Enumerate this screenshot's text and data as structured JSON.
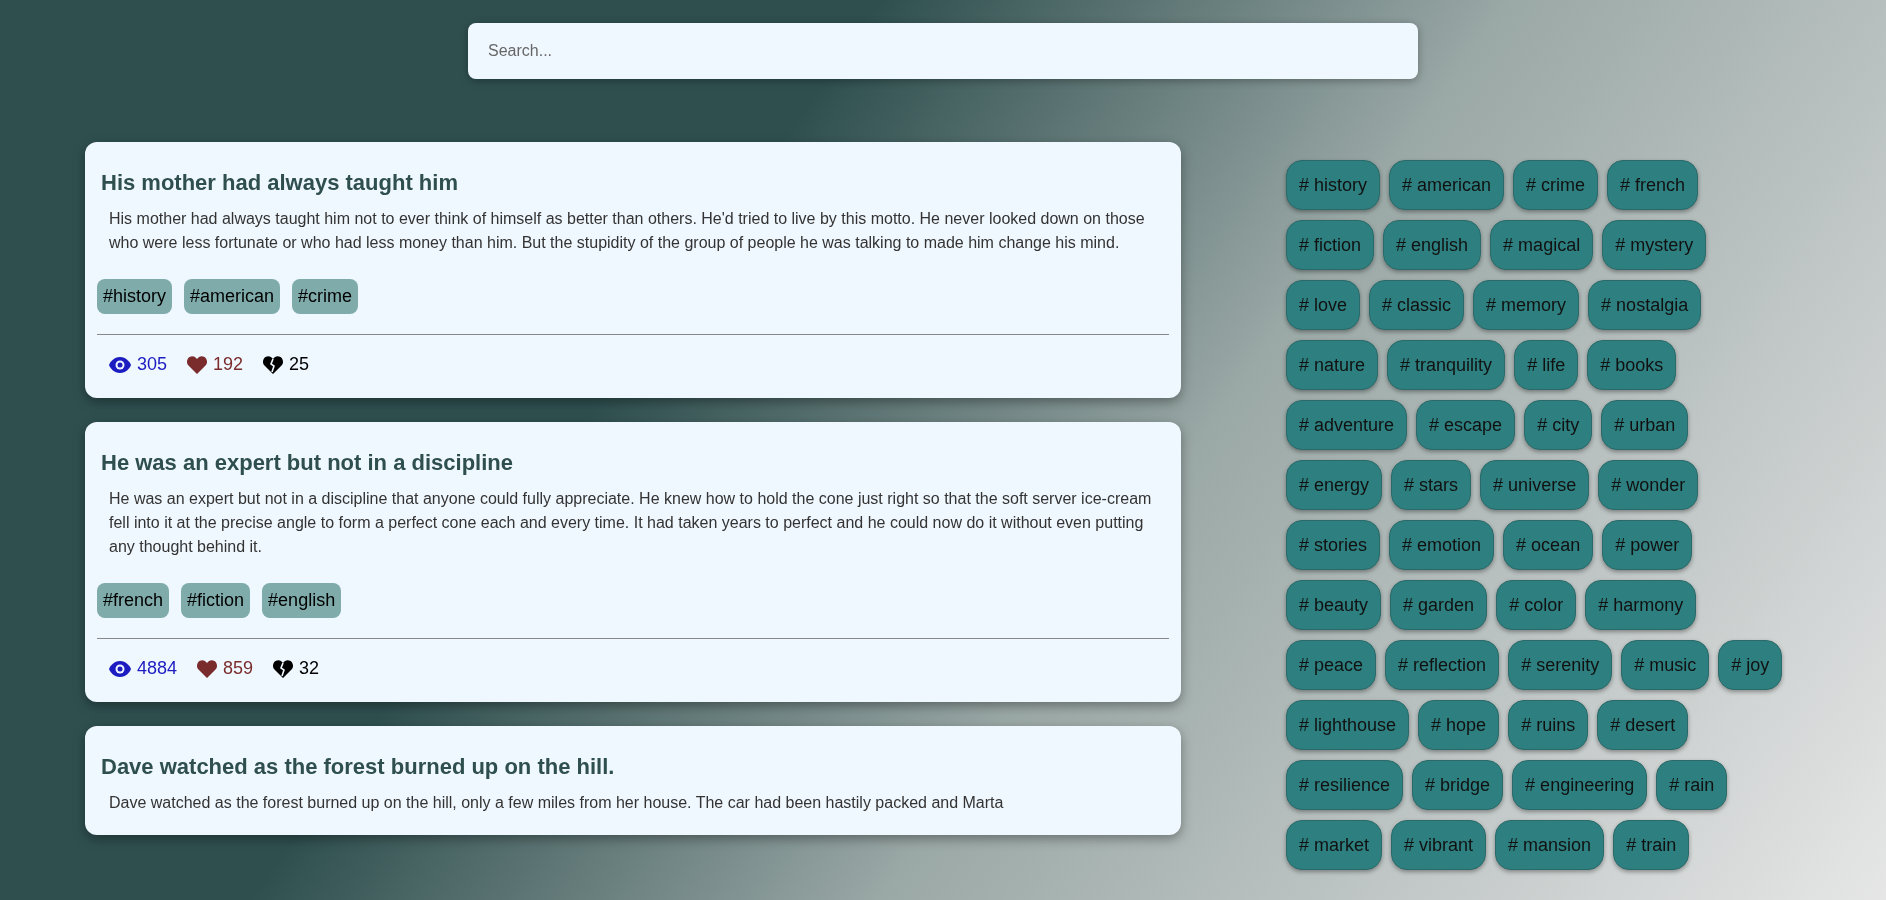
{
  "search": {
    "placeholder": "Search..."
  },
  "posts": [
    {
      "title": "His mother had always taught him",
      "body": "His mother had always taught him not to ever think of himself as better than others. He'd tried to live by this motto. He never looked down on those who were less fortunate or who had less money than him. But the stupidity of the group of people he was talking to made him change his mind.",
      "tags": [
        "#history",
        "#american",
        "#crime"
      ],
      "views": "305",
      "likes": "192",
      "dislikes": "25"
    },
    {
      "title": "He was an expert but not in a discipline",
      "body": "He was an expert but not in a discipline that anyone could fully appreciate. He knew how to hold the cone just right so that the soft server ice-cream fell into it at the precise angle to form a perfect cone each and every time. It had taken years to perfect and he could now do it without even putting any thought behind it.",
      "tags": [
        "#french",
        "#fiction",
        "#english"
      ],
      "views": "4884",
      "likes": "859",
      "dislikes": "32"
    },
    {
      "title": "Dave watched as the forest burned up on the hill.",
      "body": "Dave watched as the forest burned up on the hill, only a few miles from her house. The car had been hastily packed and Marta"
    }
  ],
  "tag_cloud": [
    "# history",
    "# american",
    "# crime",
    "# french",
    "# fiction",
    "# english",
    "# magical",
    "# mystery",
    "# love",
    "# classic",
    "# memory",
    "# nostalgia",
    "# nature",
    "# tranquility",
    "# life",
    "# books",
    "# adventure",
    "# escape",
    "# city",
    "# urban",
    "# energy",
    "# stars",
    "# universe",
    "# wonder",
    "# stories",
    "# emotion",
    "# ocean",
    "# power",
    "# beauty",
    "# garden",
    "# color",
    "# harmony",
    "# peace",
    "# reflection",
    "# serenity",
    "# music",
    "# joy",
    "# lighthouse",
    "# hope",
    "# ruins",
    "# desert",
    "# resilience",
    "# bridge",
    "# engineering",
    "# rain",
    "# market",
    "# vibrant",
    "# mansion",
    "# train"
  ]
}
